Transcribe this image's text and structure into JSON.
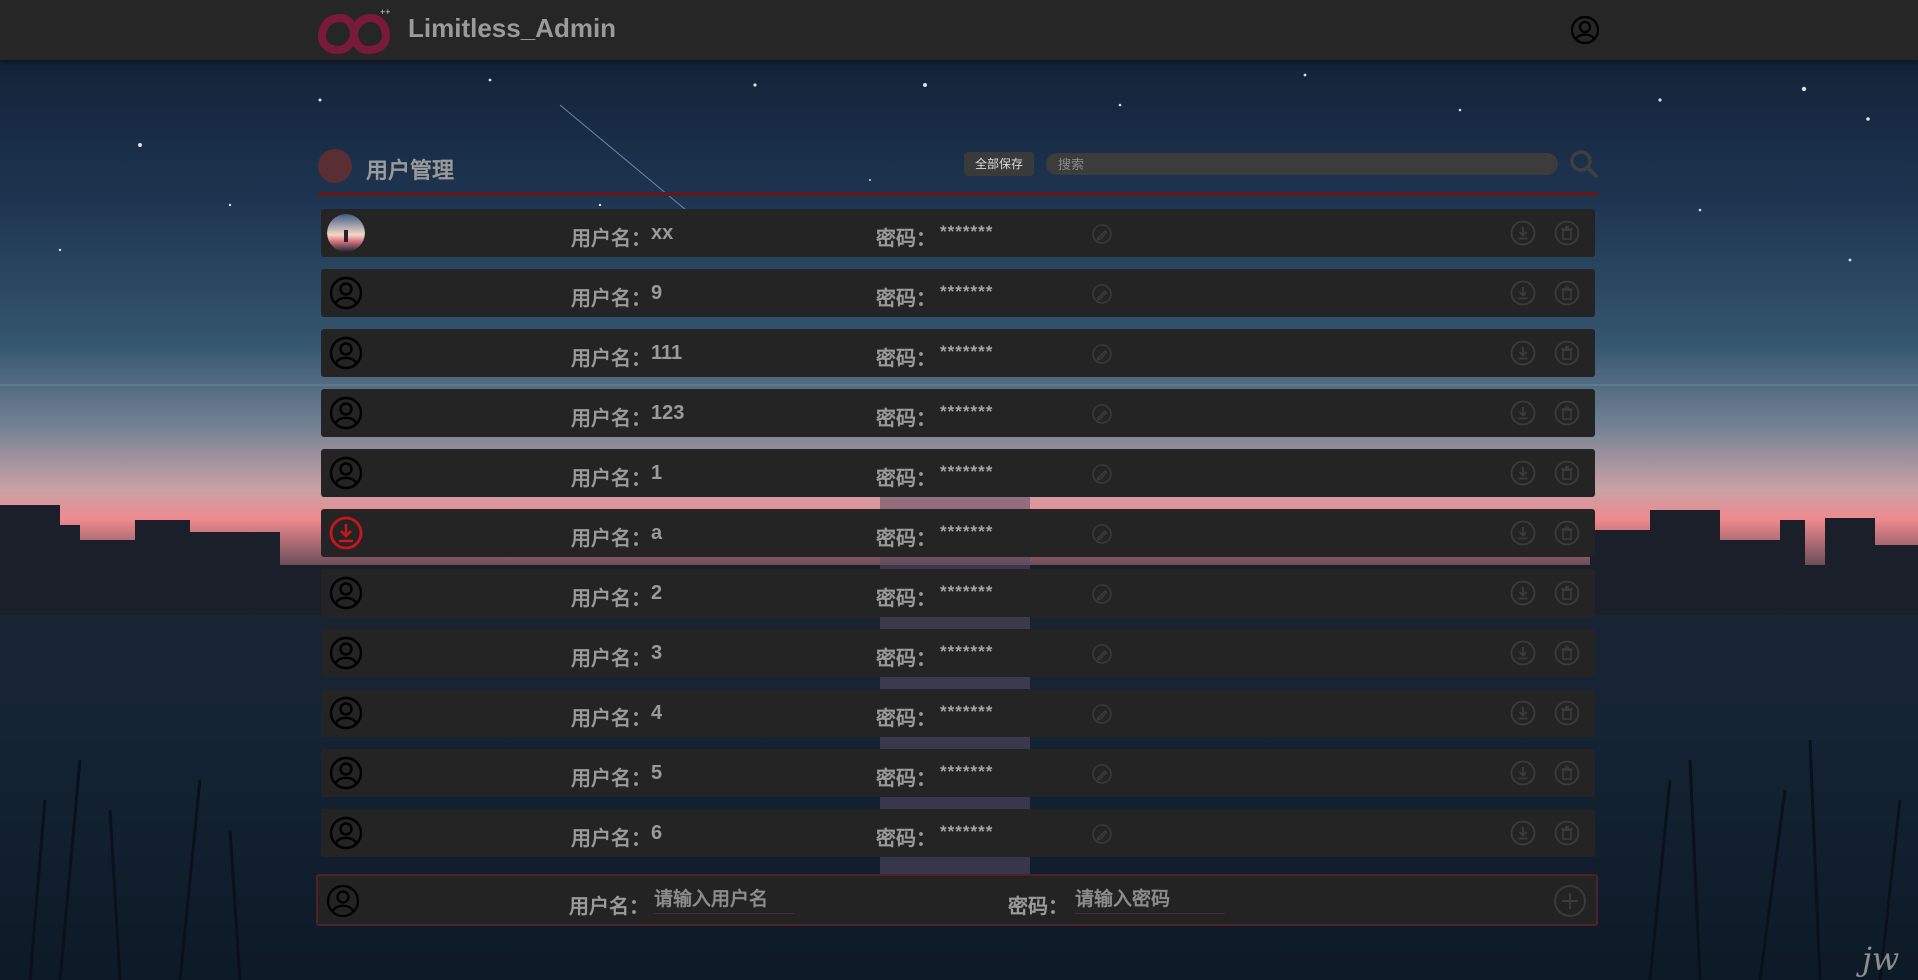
{
  "app": {
    "title": "Limitless_Admin"
  },
  "section": {
    "title": "用户管理",
    "save_all_label": "全部保存",
    "search_placeholder": "搜索"
  },
  "row_labels": {
    "username_label": "用户名：",
    "password_label": "密码：",
    "password_mask": "*******"
  },
  "users": [
    {
      "username": "xx",
      "avatar": "photo"
    },
    {
      "username": "9",
      "avatar": "default"
    },
    {
      "username": "111",
      "avatar": "default"
    },
    {
      "username": "123",
      "avatar": "default"
    },
    {
      "username": "1",
      "avatar": "default"
    },
    {
      "username": "a",
      "avatar": "red-download"
    },
    {
      "username": "2",
      "avatar": "default"
    },
    {
      "username": "3",
      "avatar": "default"
    },
    {
      "username": "4",
      "avatar": "default"
    },
    {
      "username": "5",
      "avatar": "default"
    },
    {
      "username": "6",
      "avatar": "default"
    }
  ],
  "add_form": {
    "username_label": "用户名：",
    "username_placeholder": "请输入用户名",
    "password_label": "密码：",
    "password_placeholder": "请输入密码"
  },
  "watermark": "jw",
  "colors": {
    "topbar": "#262626",
    "row_bg": "#242424",
    "accent_red": "#5b1b20",
    "logo": "#7a1a3a",
    "avatar_red": "#c8161d"
  },
  "icons": [
    "infinity-logo-icon",
    "account-icon",
    "search-icon",
    "edit-icon",
    "download-icon",
    "delete-icon",
    "add-icon",
    "user-avatar-icon"
  ]
}
